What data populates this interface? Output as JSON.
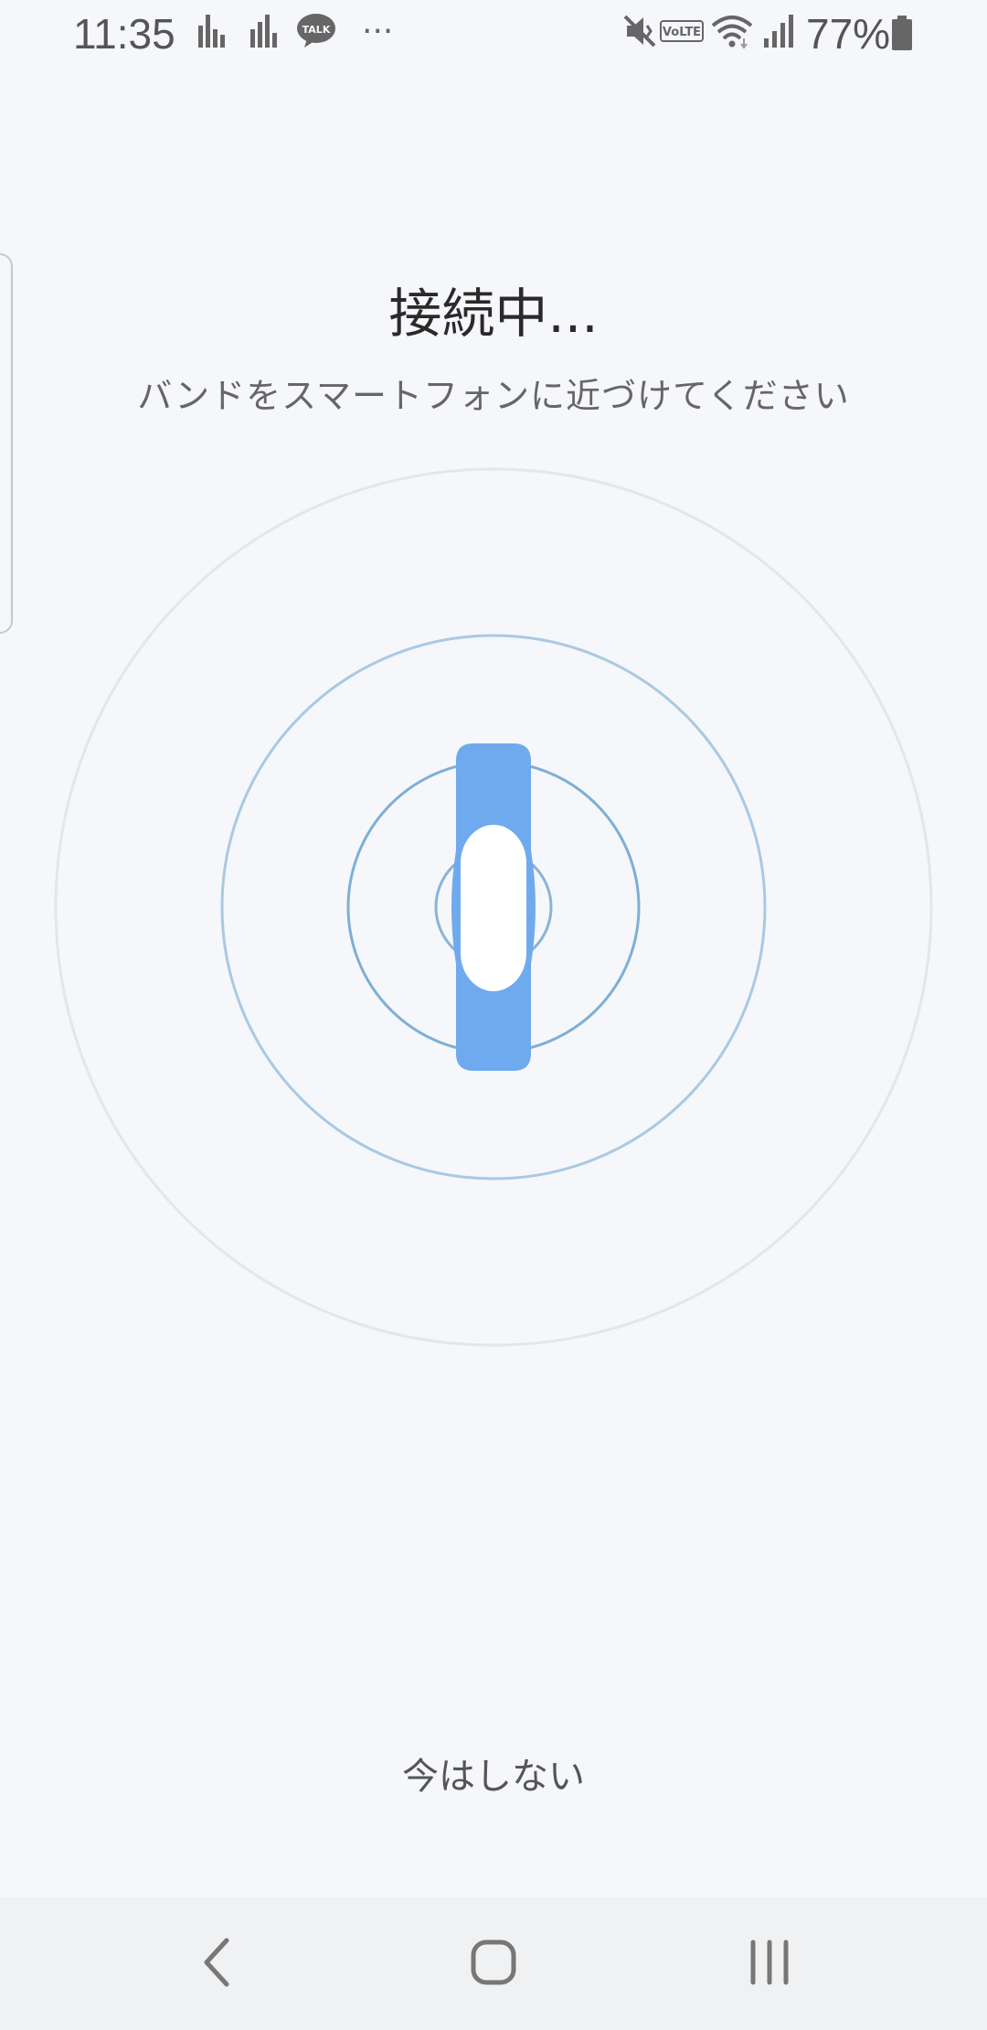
{
  "status_bar": {
    "time": "11:35",
    "battery_percent": "77%",
    "badge_talk": "TALK",
    "badge_volte": "VoLTE",
    "overflow": "···",
    "icons": [
      "bar-chart-icon",
      "bar-chart-icon",
      "kakaotalk-icon",
      "more-icon",
      "mute-icon",
      "volte-icon",
      "wifi-icon",
      "signal-icon",
      "battery-icon"
    ]
  },
  "main": {
    "title": "接続中...",
    "subtitle": "バンドをスマートフォンに近づけてください",
    "skip_label": "今はしない"
  },
  "illustration": {
    "icon": "smart-band-icon",
    "band_color": "#6faaee",
    "ring_colors": [
      "#e3e6ea",
      "#a9c9e3",
      "#7eafd6",
      "#8ab4d9"
    ]
  },
  "nav_bar": {
    "icons": [
      "back-icon",
      "home-icon",
      "recents-icon"
    ]
  }
}
